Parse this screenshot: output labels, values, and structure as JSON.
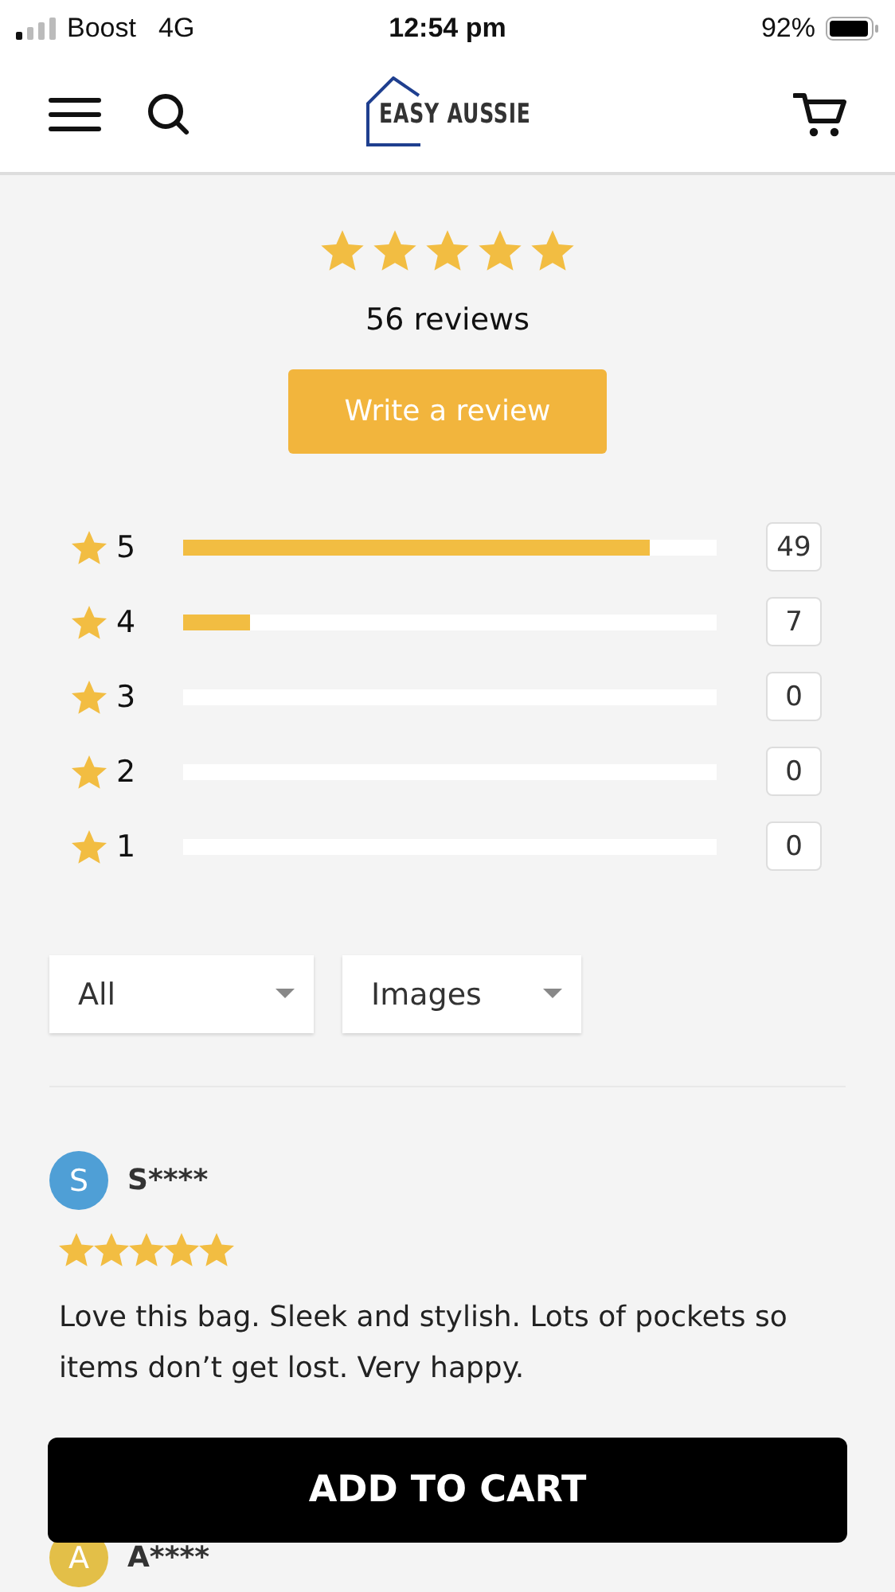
{
  "status_bar": {
    "carrier": "Boost",
    "network": "4G",
    "time": "12:54 pm",
    "battery": "92%"
  },
  "header": {
    "logo": "EASY AUSSIE"
  },
  "summary": {
    "stars": 5,
    "count": "56 reviews",
    "button": "Write a review"
  },
  "distribution": [
    {
      "star": "5",
      "level": 0.875,
      "count": "49"
    },
    {
      "star": "4",
      "level": 0.125,
      "count": "7"
    },
    {
      "star": "3",
      "level": 0,
      "count": "0"
    },
    {
      "star": "2",
      "level": 0,
      "count": "0"
    },
    {
      "star": "1",
      "level": 0,
      "count": "0"
    }
  ],
  "filters": [
    {
      "value": "All"
    },
    {
      "value": "Images"
    }
  ],
  "reviews": [
    {
      "initial": "S",
      "name": "S****",
      "color": "#4f9fd6",
      "stars": 5,
      "text": "Love this bag. Sleek and stylish. Lots of pockets so items don’t get lost. Very happy."
    },
    {
      "initial": "A",
      "name": "A****",
      "color": "#e3bf48"
    }
  ],
  "cart_button": "ADD TO CART"
}
